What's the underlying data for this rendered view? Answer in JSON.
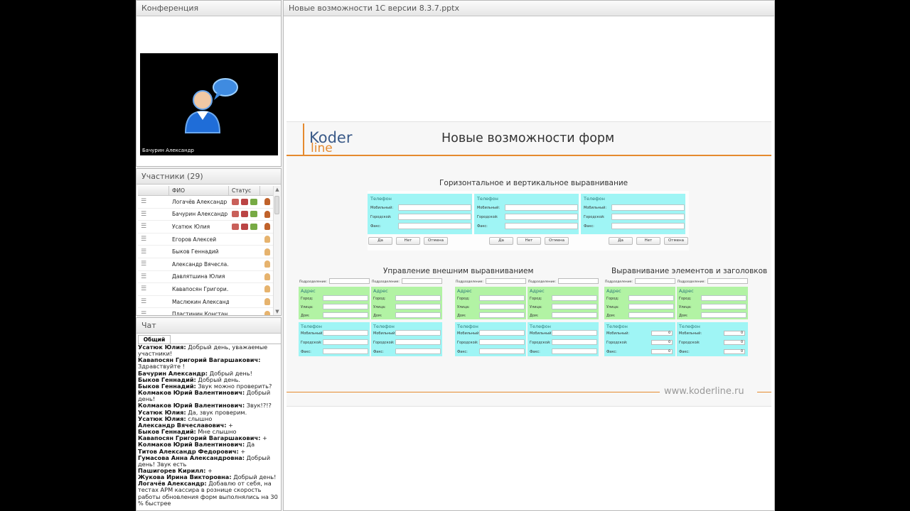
{
  "conference": {
    "title": "Конференция",
    "video_name": "Бачурин Александр"
  },
  "participants": {
    "title": "Участники (29)",
    "col_name": "ФИО",
    "col_status": "Статус",
    "rows": [
      {
        "name": "Логачёв Александр",
        "icons": true
      },
      {
        "name": "Бачурин Александр",
        "icons": true
      },
      {
        "name": "Усатюк Юлия",
        "icons": true
      },
      {
        "name": "Егоров Алексей",
        "icons": false
      },
      {
        "name": "Быков Геннадий",
        "icons": false
      },
      {
        "name": "Александр Вячесла...",
        "icons": false
      },
      {
        "name": "Давлятшина Юлия",
        "icons": false
      },
      {
        "name": "Кавапосян Григори...",
        "icons": false
      },
      {
        "name": "Маслюкин Александр",
        "icons": false
      },
      {
        "name": "Пластинин Констан...",
        "icons": false
      }
    ]
  },
  "chat": {
    "title": "Чат",
    "tab": "Общий",
    "messages": [
      {
        "author": "Усатюк Юлия:",
        "text": " Добрый день, уважаемые участники!"
      },
      {
        "author": "Кавапосян Григорий Вагаршакович:",
        "text": " Здравствуйте !"
      },
      {
        "author": "Бачурин Александр:",
        "text": " Добрый день!"
      },
      {
        "author": "Быков Геннадий:",
        "text": " Добрый день."
      },
      {
        "author": "Быков Геннадий:",
        "text": " Звук можно проверить?"
      },
      {
        "author": "Колмаков Юрий Валентинович:",
        "text": " Добрый день!"
      },
      {
        "author": "Колмаков Юрий Валентинович:",
        "text": " Звук!?!?"
      },
      {
        "author": "Усатюк Юлия:",
        "text": " Да, звук проверим."
      },
      {
        "author": "Усатюк Юлия:",
        "text": " слышно"
      },
      {
        "author": "Александр Вячеславович:",
        "text": " +"
      },
      {
        "author": "Быков Геннадий:",
        "text": " Мне слышно"
      },
      {
        "author": "Кавапосян Григорий Вагаршакович:",
        "text": " +"
      },
      {
        "author": "Колмаков Юрий Валентинович:",
        "text": " Да"
      },
      {
        "author": "Титов Александр Федорович:",
        "text": " +"
      },
      {
        "author": "Гумасова Анна Александровна:",
        "text": " Добрый день! Звук есть"
      },
      {
        "author": "Пашигорев Кирилл:",
        "text": " +"
      },
      {
        "author": "Жукова Ирина  Викторовна:",
        "text": " Добрый день!"
      },
      {
        "author": "Логачёв Александр:",
        "text": " Добавлю от себя, на тестах АРМ  кассира в рознице скорость работы обновления форм выполнялись на 30 % быстрее"
      }
    ]
  },
  "presentation": {
    "title": "Новые возможности 1С версии 8.3.7.pptx",
    "logo_top": "Koder",
    "logo_bottom": "line",
    "slide_title": "Новые возможности форм",
    "section1": "Горизонтальное и вертикальное выравнивание",
    "section2": "Управление внешним выравниванием",
    "section3": "Выравнивание элементов и заголовков",
    "site": "www.koderline.ru",
    "phone_label": "Телефон",
    "address_label": "Адрес",
    "mobile": "Мобильный:",
    "city_phone": "Городской:",
    "fax": "Факс:",
    "city": "Город:",
    "street": "Улица:",
    "house": "Дом:",
    "division": "Подразделение:",
    "btn_yes": "Да",
    "btn_no": "Нет",
    "btn_cancel": "Отмена",
    "zero": "0"
  }
}
